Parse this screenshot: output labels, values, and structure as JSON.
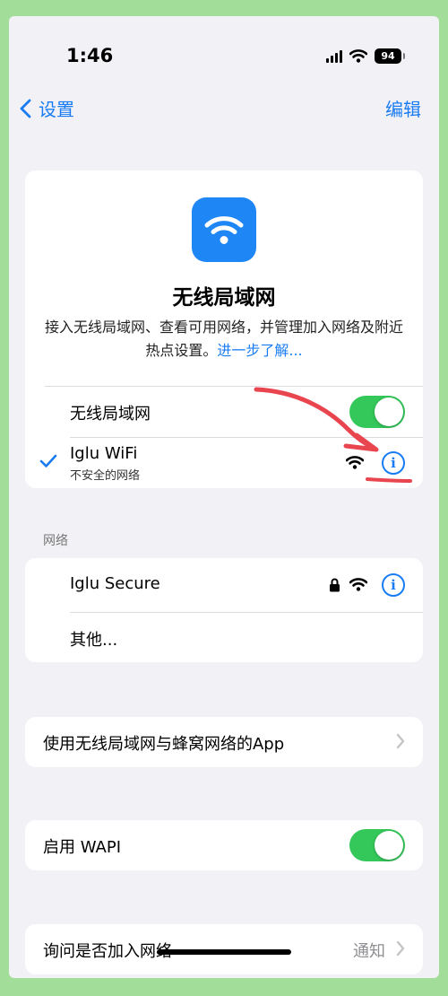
{
  "status_bar": {
    "time": "1:46",
    "battery": "94"
  },
  "nav": {
    "back_label": "设置",
    "edit_label": "编辑"
  },
  "hero": {
    "title": "无线局域网",
    "description": "接入无线局域网、查看可用网络，并管理加入网络及附近热点设置。",
    "learn_more": "进一步了解..."
  },
  "wifi_toggle": {
    "label": "无线局域网",
    "on": true
  },
  "connected": {
    "name": "Iglu WiFi",
    "subtitle": "不安全的网络"
  },
  "networks": {
    "header": "网络",
    "items": [
      {
        "name": "Iglu Secure",
        "locked": true
      }
    ],
    "other_label": "其他..."
  },
  "apps_row": {
    "label": "使用无线局域网与蜂窝网络的App"
  },
  "wapi_row": {
    "label": "启用 WAPI",
    "on": true
  },
  "ask_join_row": {
    "label": "询问是否加入网络",
    "value": "通知"
  },
  "colors": {
    "accent": "#1a7cf2",
    "toggle_on": "#34c759",
    "annotation": "#e8454f"
  }
}
